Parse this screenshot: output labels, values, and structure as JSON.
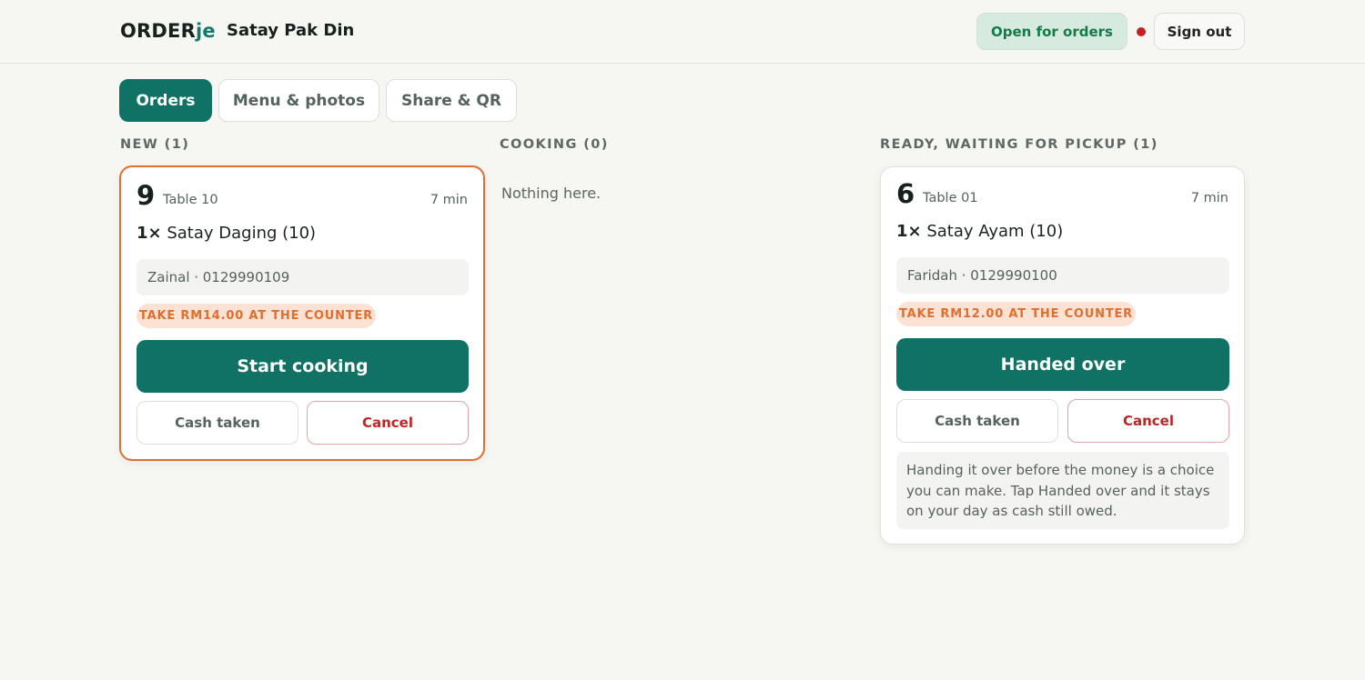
{
  "header": {
    "brand_main": "ORDER",
    "brand_accent": "je",
    "shop_name": "Satay Pak Din",
    "status_label": "Open for orders",
    "sign_out_label": "Sign out"
  },
  "tabs": [
    {
      "label": "Orders",
      "active": true
    },
    {
      "label": "Menu & photos",
      "active": false
    },
    {
      "label": "Share & QR",
      "active": false
    }
  ],
  "columns": {
    "new": {
      "title": "NEW (1)"
    },
    "cooking": {
      "title": "COOKING (0)",
      "empty_text": "Nothing here."
    },
    "ready": {
      "title": "READY, WAITING FOR PICKUP (1)"
    }
  },
  "orders": {
    "new": {
      "number": "9",
      "table": "Table 10",
      "elapsed": "7 min",
      "qty": "1×",
      "item": " Satay Daging (10)",
      "customer": "Zainal · 0129990109",
      "payment_due": "TAKE RM14.00 AT THE COUNTER",
      "primary_action": "Start cooking",
      "cash_label": "Cash taken",
      "cancel_label": "Cancel"
    },
    "ready": {
      "number": "6",
      "table": "Table 01",
      "elapsed": "7 min",
      "qty": "1×",
      "item": " Satay Ayam (10)",
      "customer": "Faridah · 0129990100",
      "payment_due": "TAKE RM12.00 AT THE COUNTER",
      "primary_action": "Handed over",
      "cash_label": "Cash taken",
      "cancel_label": "Cancel",
      "note": "Handing it over before the money is a choice you can make. Tap Handed over and it stays on your day as cash still owed."
    }
  },
  "colors": {
    "accent": "#107264",
    "new_border": "#e06f2d",
    "open_status": "#137b48",
    "danger": "#c02525"
  }
}
